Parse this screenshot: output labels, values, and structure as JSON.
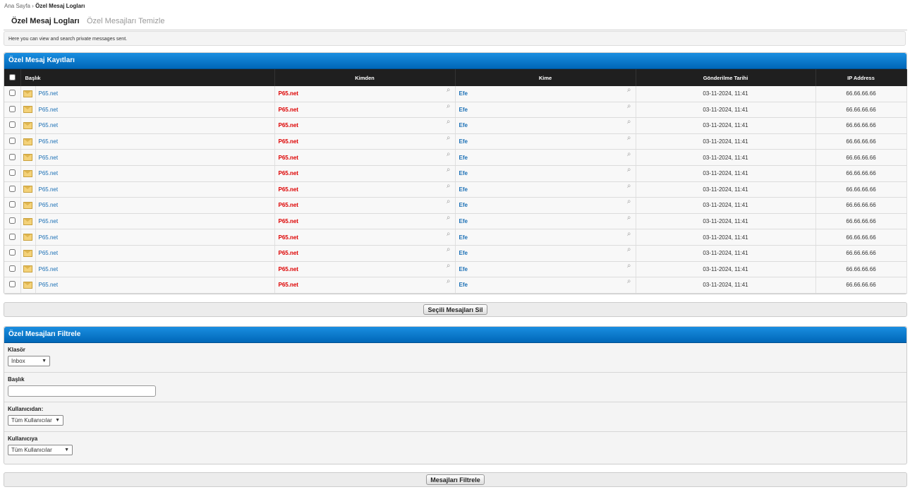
{
  "breadcrumb": {
    "home": "Ana Sayfa",
    "sep": "›",
    "current": "Özel Mesaj Logları"
  },
  "tabs": {
    "active": "Özel Mesaj Logları",
    "other": "Özel Mesajları Temizle"
  },
  "intro": "Here you can view and search private messages sent.",
  "logs": {
    "title": "Özel Mesaj Kayıtları",
    "columns": {
      "subject": "Başlık",
      "from": "Kimden",
      "to": "Kime",
      "date": "Gönderilme Tarihi",
      "ip": "IP Address"
    },
    "rows": [
      {
        "subject": "P65.net",
        "from": "P65.net",
        "to": "Efe",
        "date": "03-11-2024, 11:41",
        "ip": "66.66.66.66"
      },
      {
        "subject": "P65.net",
        "from": "P65.net",
        "to": "Efe",
        "date": "03-11-2024, 11:41",
        "ip": "66.66.66.66"
      },
      {
        "subject": "P65.net",
        "from": "P65.net",
        "to": "Efe",
        "date": "03-11-2024, 11:41",
        "ip": "66.66.66.66"
      },
      {
        "subject": "P65.net",
        "from": "P65.net",
        "to": "Efe",
        "date": "03-11-2024, 11:41",
        "ip": "66.66.66.66"
      },
      {
        "subject": "P65.net",
        "from": "P65.net",
        "to": "Efe",
        "date": "03-11-2024, 11:41",
        "ip": "66.66.66.66"
      },
      {
        "subject": "P65.net",
        "from": "P65.net",
        "to": "Efe",
        "date": "03-11-2024, 11:41",
        "ip": "66.66.66.66"
      },
      {
        "subject": "P65.net",
        "from": "P65.net",
        "to": "Efe",
        "date": "03-11-2024, 11:41",
        "ip": "66.66.66.66"
      },
      {
        "subject": "P65.net",
        "from": "P65.net",
        "to": "Efe",
        "date": "03-11-2024, 11:41",
        "ip": "66.66.66.66"
      },
      {
        "subject": "P65.net",
        "from": "P65.net",
        "to": "Efe",
        "date": "03-11-2024, 11:41",
        "ip": "66.66.66.66"
      },
      {
        "subject": "P65.net",
        "from": "P65.net",
        "to": "Efe",
        "date": "03-11-2024, 11:41",
        "ip": "66.66.66.66"
      },
      {
        "subject": "P65.net",
        "from": "P65.net",
        "to": "Efe",
        "date": "03-11-2024, 11:41",
        "ip": "66.66.66.66"
      },
      {
        "subject": "P65.net",
        "from": "P65.net",
        "to": "Efe",
        "date": "03-11-2024, 11:41",
        "ip": "66.66.66.66"
      },
      {
        "subject": "P65.net",
        "from": "P65.net",
        "to": "Efe",
        "date": "03-11-2024, 11:41",
        "ip": "66.66.66.66"
      }
    ],
    "delete_label": "Seçili Mesajları Sil"
  },
  "filter": {
    "title": "Özel Mesajları Filtrele",
    "folder_label": "Klasör",
    "folder_value": "Inbox",
    "subject_label": "Başlık",
    "subject_value": "",
    "from_label": "Kullanıcıdan:",
    "from_value": "Tüm Kullanıcılar",
    "to_label": "Kullanıcıya",
    "to_value": "Tüm Kullanıcılar",
    "submit_label": "Mesajları Filtrele"
  },
  "colors": {
    "header_blue": "#0067b8",
    "from_red": "#dd0000",
    "link_blue": "#1a6fb5",
    "table_head": "#1f1f1f"
  }
}
